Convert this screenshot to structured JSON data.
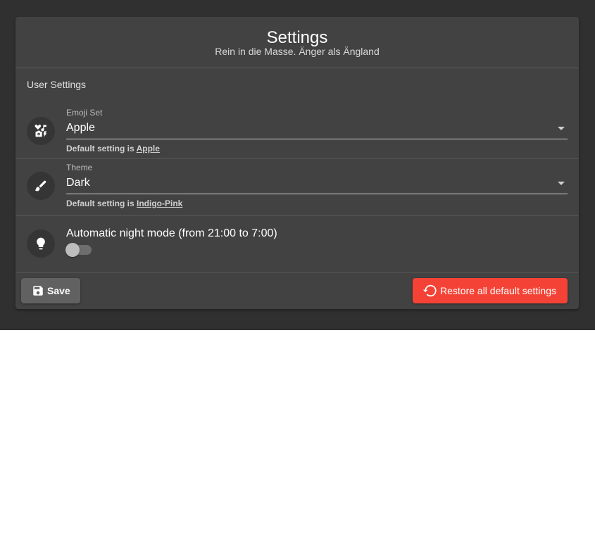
{
  "header": {
    "title": "Settings",
    "subtitle": "Rein in die Masse. Änger als Ängland"
  },
  "section": {
    "label": "User Settings"
  },
  "emoji": {
    "label": "Emoji Set",
    "value": "Apple",
    "hint_prefix": "Default setting is ",
    "default": "Apple",
    "icon": "emoji-symbols-icon"
  },
  "theme": {
    "label": "Theme",
    "value": "Dark",
    "hint_prefix": "Default setting is ",
    "default": "Indigo-Pink",
    "icon": "brush-icon"
  },
  "night_mode": {
    "label": "Automatic night mode (from 21:00 to 7:00)",
    "enabled": false,
    "icon": "lightbulb-icon"
  },
  "actions": {
    "save_label": "Save",
    "restore_label": "Restore all default settings",
    "save_icon": "save-icon",
    "restore_icon": "restore-icon"
  },
  "colors": {
    "background": "#303030",
    "card": "#424242",
    "warn": "#f44336",
    "save_button": "#616161"
  }
}
